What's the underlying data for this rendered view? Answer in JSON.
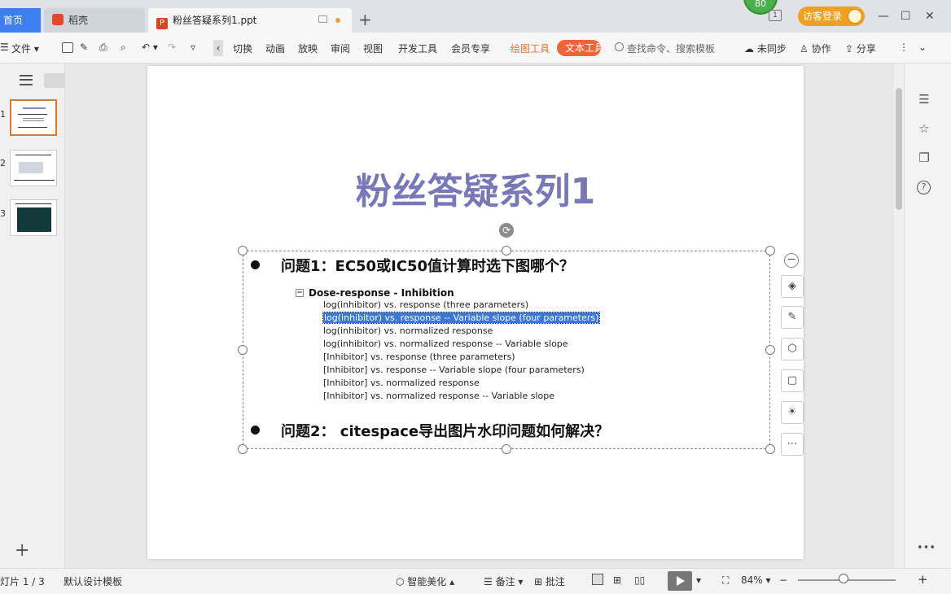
{
  "tabs": {
    "home": "首页",
    "daoke": "稻壳",
    "doc": "粉丝答疑系列1.ppt",
    "doc_icon": "P",
    "add": "+"
  },
  "topright": {
    "badge": "80",
    "phone_badge": "1",
    "login": "访客登录",
    "minimize": "—",
    "maximize": "☐",
    "close": "✕"
  },
  "toolbar": {
    "file": "文件",
    "menus": [
      "切换",
      "动画",
      "放映",
      "审阅",
      "视图",
      "开发工具",
      "会员专享"
    ],
    "draw_tools": "绘图工具",
    "text_tools": "文本工具",
    "search_placeholder": "查找命令、搜索模板",
    "sync": "未同步",
    "collab": "协作",
    "share": "分享",
    "more": "⋮",
    "collapse": "⌄"
  },
  "thumbs": [
    "1",
    "2",
    "3"
  ],
  "slide": {
    "title": "粉丝答疑系列1",
    "q1": "问题1：EC50或IC50值计算时选下图哪个？",
    "tree_head": "Dose-response - Inhibition",
    "tree_items": [
      "log(inhibitor) vs. response (three parameters)",
      "log(inhibitor) vs. response -- Variable slope (four parameters)",
      "log(inhibitor) vs. normalized response",
      "log(inhibitor) vs. normalized response -- Variable slope",
      "[Inhibitor] vs. response (three parameters)",
      "[Inhibitor] vs. response -- Variable slope (four parameters)",
      "[Inhibitor] vs. normalized response",
      "[Inhibitor] vs. normalized response -- Variable slope"
    ],
    "selected_index": 1,
    "q2": "问题2： citespace导出图片水印问题如何解决？"
  },
  "status": {
    "slide_info": "灯片 1 / 3",
    "template": "默认设计模板",
    "beautify": "智能美化",
    "notes": "备注",
    "comment": "批注",
    "zoom": "84%",
    "zoom_level_percent": 84,
    "zoom_out": "−",
    "zoom_in": "+"
  }
}
